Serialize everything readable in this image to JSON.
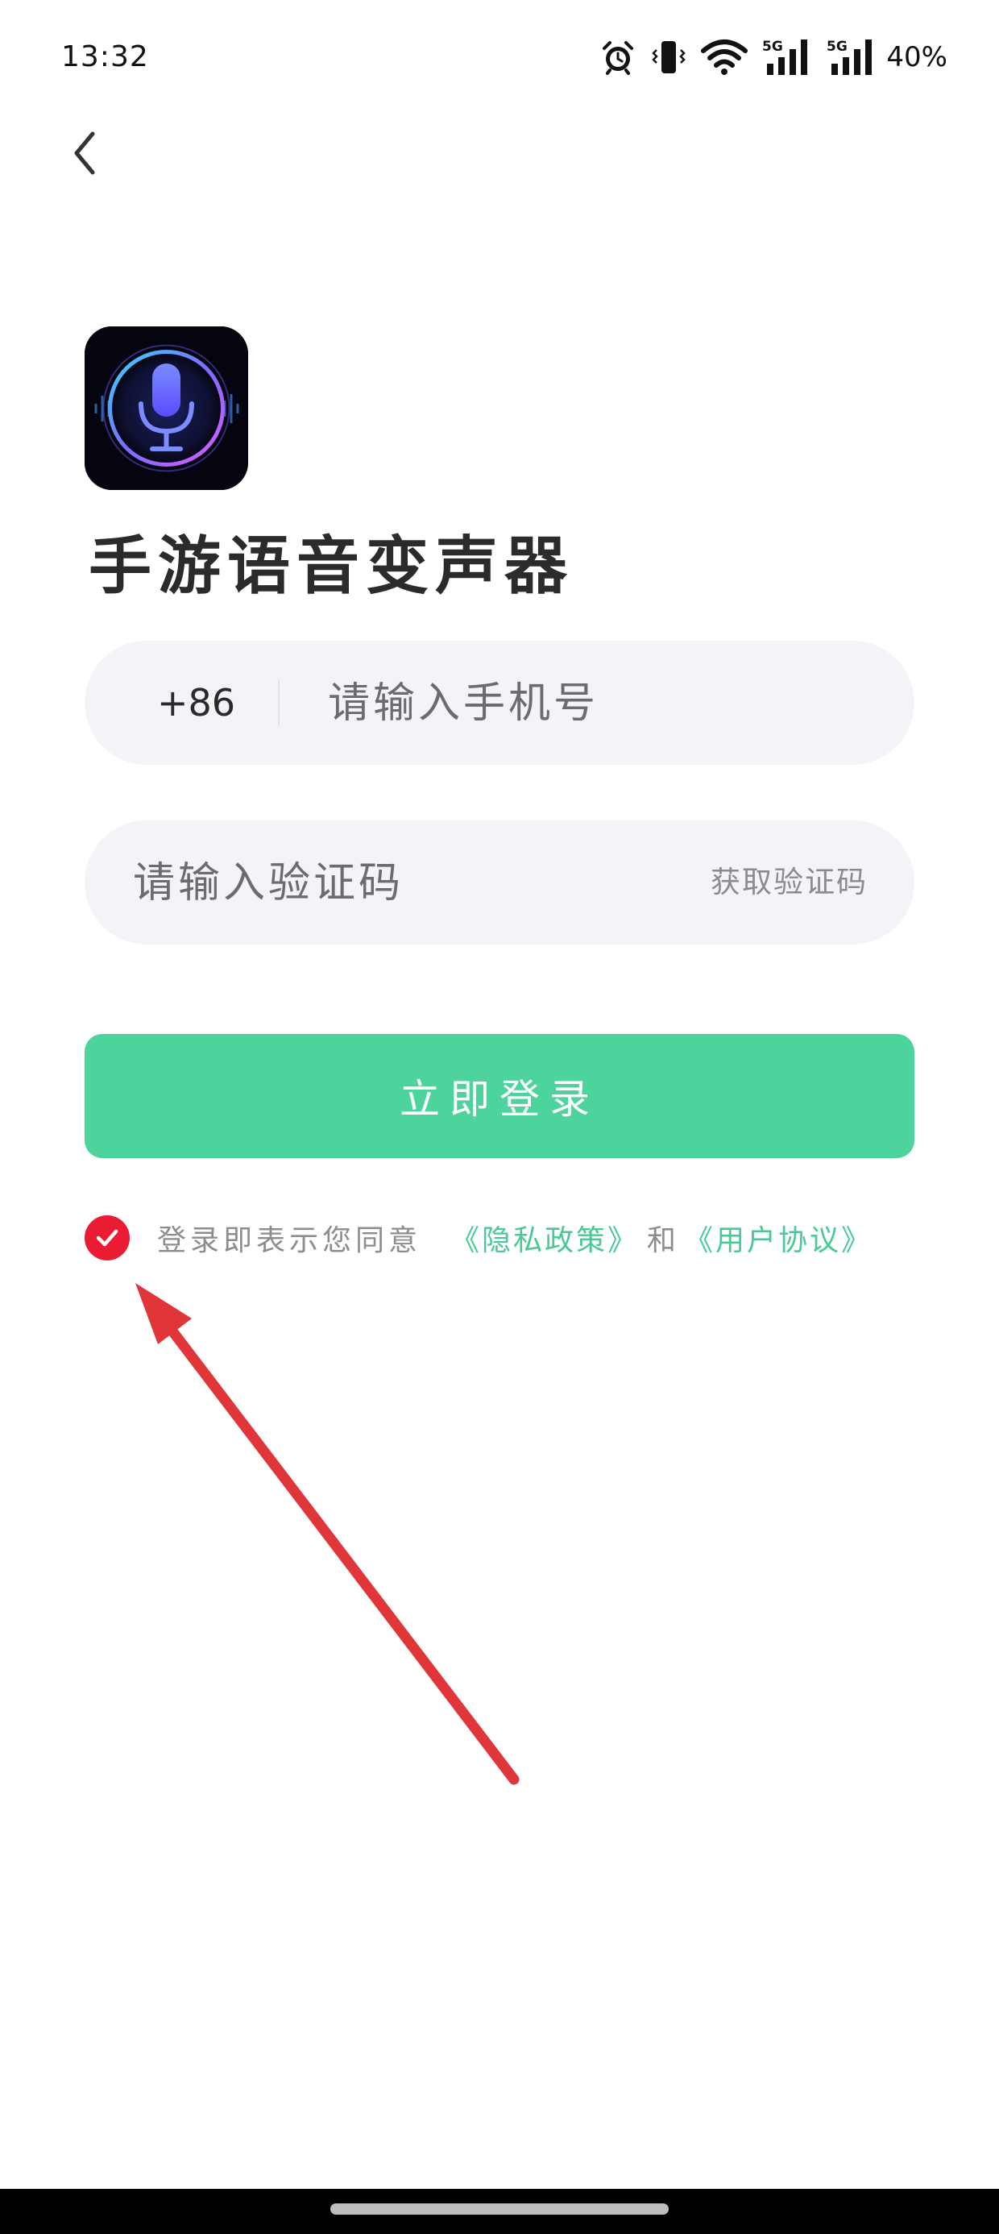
{
  "status_bar": {
    "time": "13:32",
    "network_label_1": "5G",
    "network_label_2": "5G",
    "battery": "40%"
  },
  "icons": {
    "back": "back-arrow-icon",
    "alarm": "alarm-icon",
    "vibrate": "vibrate-icon",
    "wifi": "wifi-icon",
    "signal": "signal-icon",
    "logo": "microphone-icon",
    "check": "check-icon"
  },
  "app": {
    "title": "手游语音变声器"
  },
  "login_form": {
    "country_code": "+86",
    "phone_placeholder": "请输入手机号",
    "code_placeholder": "请输入验证码",
    "get_code_label": "获取验证码",
    "login_label": "立即登录"
  },
  "agreement": {
    "checked": true,
    "prefix": "登录即表示您同意",
    "privacy_link": "《隐私政策》",
    "and": "和",
    "user_link": "《用户协议》"
  },
  "colors": {
    "accent_green": "#4dd49c",
    "link_green": "#48c995",
    "checkbox_red": "#ea1c33",
    "annotation_red": "#e0363a",
    "field_bg": "#f3f3f8"
  }
}
